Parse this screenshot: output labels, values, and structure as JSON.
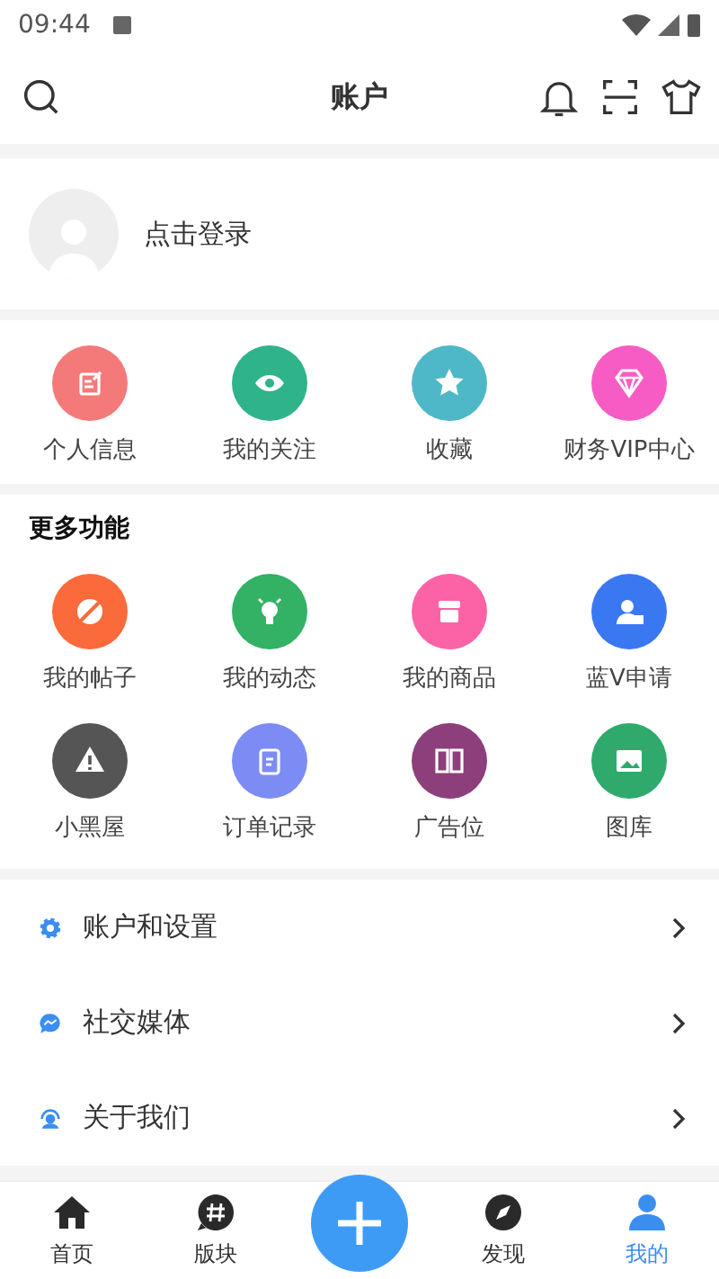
{
  "status_bar": {
    "time": "09:44"
  },
  "header": {
    "title": "账户"
  },
  "login": {
    "label": "点击登录"
  },
  "quick_items": [
    {
      "label": "个人信息",
      "color": "#f47a7a"
    },
    {
      "label": "我的关注",
      "color": "#2fb38a"
    },
    {
      "label": "收藏",
      "color": "#4fb8c8"
    },
    {
      "label": "财务VIP中心",
      "color": "#f75cc4"
    }
  ],
  "more": {
    "title": "更多功能",
    "items": [
      {
        "label": "我的帖子",
        "color": "#fb6a3a"
      },
      {
        "label": "我的动态",
        "color": "#33b165"
      },
      {
        "label": "我的商品",
        "color": "#fb63a6"
      },
      {
        "label": "蓝V申请",
        "color": "#3a78f2"
      },
      {
        "label": "小黑屋",
        "color": "#555555"
      },
      {
        "label": "订单记录",
        "color": "#7d8cf4"
      },
      {
        "label": "广告位",
        "color": "#8c3f7a"
      },
      {
        "label": "图库",
        "color": "#2faa6c"
      }
    ]
  },
  "menu": [
    {
      "label": "账户和设置"
    },
    {
      "label": "社交媒体"
    },
    {
      "label": "关于我们"
    }
  ],
  "bottom_nav": [
    {
      "label": "首页",
      "selected": false
    },
    {
      "label": "版块",
      "selected": false
    },
    {
      "label": "发现",
      "selected": false
    },
    {
      "label": "我的",
      "selected": true
    }
  ]
}
